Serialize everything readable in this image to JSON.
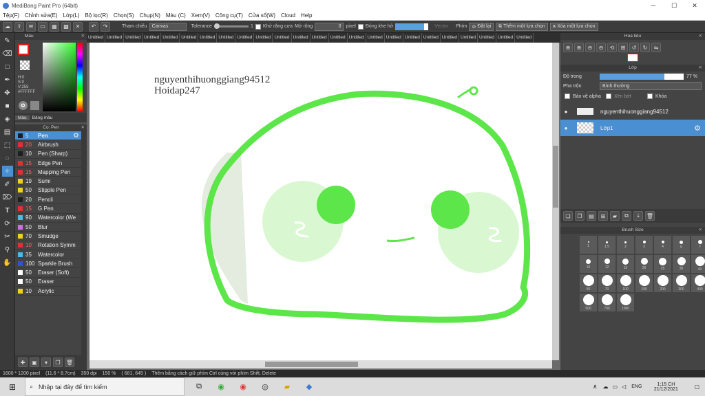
{
  "titlebar": {
    "title": "MediBang Paint Pro (64bit)",
    "min": "─",
    "max": "☐",
    "close": "✕"
  },
  "menu": [
    "Tệp(F)",
    "Chỉnh sửa(E)",
    "Lớp(L)",
    "Bộ lọc(R)",
    "Chọn(S)",
    "Chụp(N)",
    "Màu (C)",
    "Xem(V)",
    "Công cụ(T)",
    "Cửa sổ(W)",
    "Cloud",
    "Help"
  ],
  "toolbar": {
    "reference_label": "Tham chiếu",
    "reference_value": "Canvas",
    "tolerance_label": "Tolerance",
    "tolerance_value": "1",
    "antialias_label": "Khử răng cưa",
    "expand_label": "Mở rộng",
    "expand_value": "0",
    "unit": "pixel",
    "gapclose_label": "Đóng khe hở",
    "vector_label": "Vector",
    "key_label": "Phím",
    "reset_label": "Đặt lại",
    "add_selection": "Thêm một lựa chọn",
    "remove_selection": "Xóa một lựa chọn"
  },
  "color_panel": {
    "title": "Màu",
    "h": "H:0",
    "s": "S:0",
    "v": "V:255",
    "hex": "#FFFFFF",
    "tab_color": "Màu",
    "tab_palette": "Bảng màu"
  },
  "brush_panel": {
    "title": "Cọ: Pen",
    "items": [
      {
        "size": "5",
        "name": "Pen",
        "color": "#1e1e1e"
      },
      {
        "size": "20",
        "name": "Airbrush",
        "color": "#e03030"
      },
      {
        "size": "10",
        "name": "Pen (Sharp)",
        "color": "#1e1e1e"
      },
      {
        "size": "15",
        "name": "Edge Pen",
        "color": "#e03030"
      },
      {
        "size": "15",
        "name": "Mapping Pen",
        "color": "#e03030"
      },
      {
        "size": "19",
        "name": "Sumi",
        "color": "#f0d020"
      },
      {
        "size": "50",
        "name": "Stipple Pen",
        "color": "#f0d020"
      },
      {
        "size": "20",
        "name": "Pencil",
        "color": "#1e1e1e"
      },
      {
        "size": "15",
        "name": "G Pen",
        "color": "#e03030"
      },
      {
        "size": "90",
        "name": "Watercolor (We",
        "color": "#50b8e8"
      },
      {
        "size": "50",
        "name": "Blur",
        "color": "#d070e0"
      },
      {
        "size": "70",
        "name": "Smudge",
        "color": "#f0d020"
      },
      {
        "size": "10",
        "name": "Rotation Symm",
        "color": "#e03030"
      },
      {
        "size": "35",
        "name": "Watercolor",
        "color": "#50b8e8"
      },
      {
        "size": "100",
        "name": "Sparkle Brush",
        "color": "#3050e0"
      },
      {
        "size": "50",
        "name": "Eraser (Soft)",
        "color": "#ffffff"
      },
      {
        "size": "50",
        "name": "Eraser",
        "color": "#ffffff"
      },
      {
        "size": "10",
        "name": "Acrylic",
        "color": "#f0d020"
      }
    ]
  },
  "tabs": [
    "Untitled",
    "Untitled",
    "Untitled",
    "Untitled",
    "Untitled",
    "Untitled",
    "Untitled",
    "Untitled",
    "Untitled",
    "Untitled",
    "Untitled",
    "Untitled",
    "Untitled",
    "Untitled",
    "Untitled",
    "Untitled",
    "Untitled",
    "Untitled",
    "Untitled",
    "Untitled",
    "Untitled",
    "Untitled",
    "Untitled",
    "Untitled"
  ],
  "canvas": {
    "text_line1": "nguyenthihuonggiang94512",
    "text_line2": "Hoidap247",
    "stroke_color": "#5de64a",
    "fill_color": "#d9f8d2"
  },
  "navigator": {
    "title": "Hoa tiêu"
  },
  "layer_panel": {
    "title": "Lớp",
    "opacity_label": "Độ trong",
    "opacity_value": "77 %",
    "opacity_fraction": 0.77,
    "blend_label": "Pha trộn",
    "blend_value": "Bình thường",
    "protect_alpha": "Bảo vệ alpha",
    "clipping": "Xén bớt",
    "lock": "Khóa",
    "layers": [
      {
        "name": "nguyenthihuonggiang94512",
        "selected": false
      },
      {
        "name": "Lớp1",
        "selected": true
      }
    ]
  },
  "brush_size": {
    "title": "Brush Size",
    "sizes": [
      "1",
      "1.5",
      "2",
      "3",
      "4",
      "5",
      "7",
      "10",
      "12",
      "15",
      "20",
      "25",
      "30",
      "40",
      "50",
      "70",
      "100",
      "150",
      "200",
      "300",
      "400",
      "500",
      "700",
      "1000"
    ]
  },
  "status": {
    "dimensions": "1600 * 1200 pixel",
    "physical": "(11.6 * 8.7cm)",
    "dpi": "350 dpi",
    "zoom": "150 %",
    "coords": "( 681, 645 )",
    "hint": "Thêm bằng cách giữ phím Ctrl cùng với phím Shift, Delete"
  },
  "taskbar": {
    "search_placeholder": "Nhập tại đây để tìm kiếm",
    "time": "1:15 CH",
    "date": "21/12/2021",
    "lang": "ENG"
  }
}
